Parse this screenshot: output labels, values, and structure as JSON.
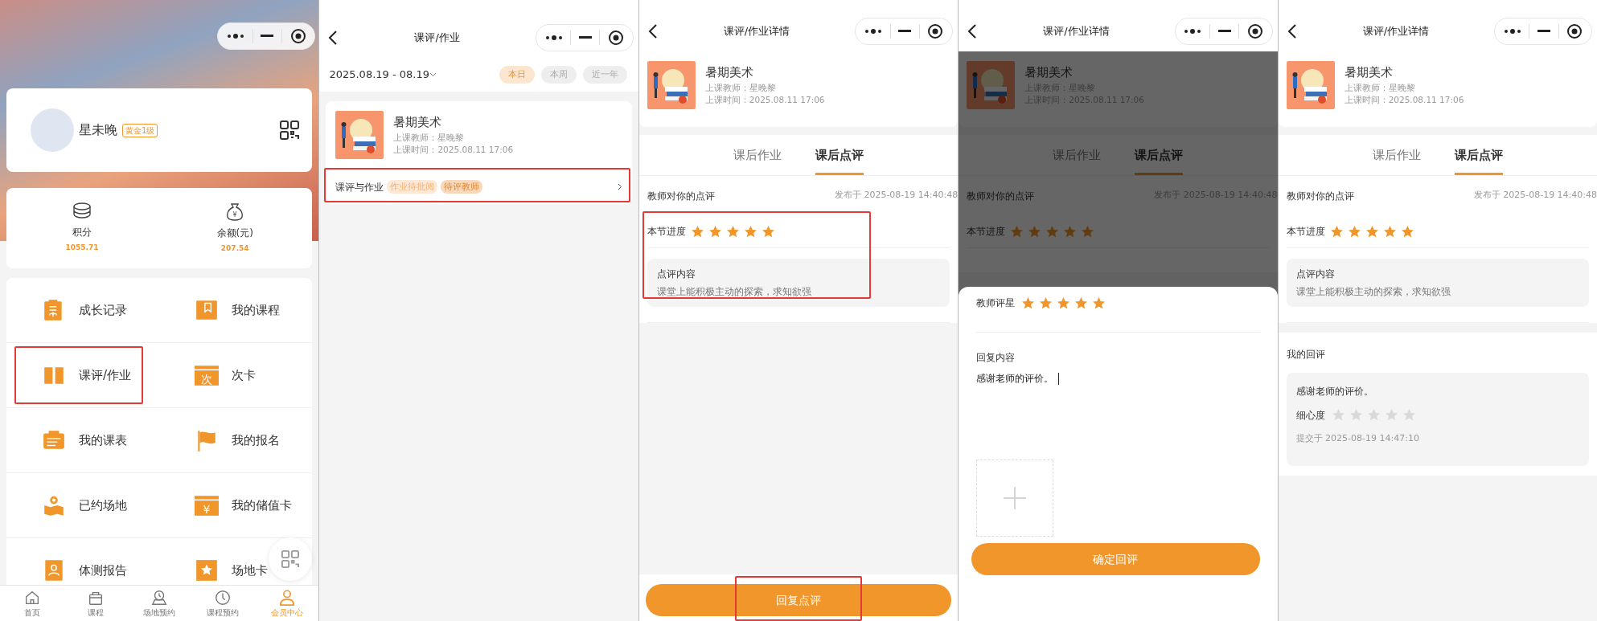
{
  "screens": [
    {
      "kind": "member",
      "profile": {
        "name": "星未晚",
        "level": "黄金1级"
      },
      "stats": [
        {
          "label": "积分",
          "value": "1055.71"
        },
        {
          "label": "余额(元)",
          "value": "207.54",
          "icon_text": "¥"
        }
      ],
      "menu": [
        {
          "label": "成长记录",
          "annotated": false
        },
        {
          "label": "我的课程",
          "annotated": false
        },
        {
          "label": "课评/作业",
          "annotated": true
        },
        {
          "label": "次卡",
          "icon_text": "次",
          "annotated": false
        },
        {
          "label": "我的课表",
          "annotated": false
        },
        {
          "label": "我的报名",
          "annotated": false
        },
        {
          "label": "已约场地",
          "annotated": false
        },
        {
          "label": "我的储值卡",
          "icon_text": "¥",
          "annotated": false
        },
        {
          "label": "体测报告",
          "annotated": false
        },
        {
          "label": "场地卡",
          "annotated": false
        }
      ],
      "tabbar": [
        {
          "label": "首页",
          "selected": false
        },
        {
          "label": "课程",
          "selected": false
        },
        {
          "label": "场地预约",
          "selected": false
        },
        {
          "label": "课程预约",
          "selected": false
        },
        {
          "label": "会员中心",
          "selected": true
        }
      ]
    },
    {
      "kind": "list",
      "title": "课评/作业",
      "date_range": "2025.08.19 - 08.19",
      "filters": [
        {
          "label": "本日",
          "selected": true
        },
        {
          "label": "本周",
          "selected": false
        },
        {
          "label": "近一年",
          "selected": false
        }
      ],
      "course": {
        "name": "暑期美术",
        "teacher": "上课教师：星晚黎",
        "time": "上课时间：2025.08.11 17:06"
      },
      "entry": {
        "label": "课评与作业",
        "annotated": true,
        "tags": [
          {
            "label": "作业待批阅",
            "color": "#fde9d6"
          },
          {
            "label": "待评教师",
            "color": "#f8d9bb"
          }
        ]
      }
    },
    {
      "kind": "detail",
      "title": "课评/作业详情",
      "dimmed": false,
      "course": {
        "name": "暑期美术",
        "teacher": "上课教师：星晚黎",
        "time": "上课时间：2025.08.11 17:06"
      },
      "tabs": [
        {
          "label": "课后作业",
          "selected": false
        },
        {
          "label": "课后点评",
          "selected": true
        }
      ],
      "review": {
        "heading": "教师对你的点评",
        "published": "发布于 2025-08-19 14:40:48",
        "progress_label": "本节进度",
        "stars": 5,
        "content_label": "点评内容",
        "content": "课堂上能积极主动的探索，求知欲强",
        "annotated": true
      },
      "reply_button": {
        "label": "回复点评",
        "annotated": true
      }
    },
    {
      "kind": "detail",
      "title": "课评/作业详情",
      "dimmed": true,
      "course": {
        "name": "暑期美术",
        "teacher": "上课教师：星晚黎",
        "time": "上课时间：2025.08.11 17:06"
      },
      "tabs": [
        {
          "label": "课后作业",
          "selected": false
        },
        {
          "label": "课后点评",
          "selected": true
        }
      ],
      "review": {
        "heading": "教师对你的点评",
        "published": "发布于 2025-08-19 14:40:48",
        "progress_label": "本节进度",
        "stars": 5,
        "annotated": false
      },
      "sheet": {
        "rating_label": "教师评星",
        "stars": 5,
        "reply_label": "回复内容",
        "reply_value": "感谢老师的评价。",
        "button": "确定回评"
      }
    },
    {
      "kind": "detail",
      "title": "课评/作业详情",
      "dimmed": false,
      "course": {
        "name": "暑期美术",
        "teacher": "上课教师：星晚黎",
        "time": "上课时间：2025.08.11 17:06"
      },
      "tabs": [
        {
          "label": "课后作业",
          "selected": false
        },
        {
          "label": "课后点评",
          "selected": true
        }
      ],
      "review": {
        "heading": "教师对你的点评",
        "published": "发布于 2025-08-19 14:40:48",
        "progress_label": "本节进度",
        "stars": 5,
        "content_label": "点评内容",
        "content": "课堂上能积极主动的探索，求知欲强",
        "annotated": false
      },
      "my_reply": {
        "heading": "我的回评",
        "text": "感谢老师的评价。",
        "rating_label": "细心度",
        "stars": 0,
        "submitted": "提交于 2025-08-19 14:47:10"
      }
    }
  ]
}
